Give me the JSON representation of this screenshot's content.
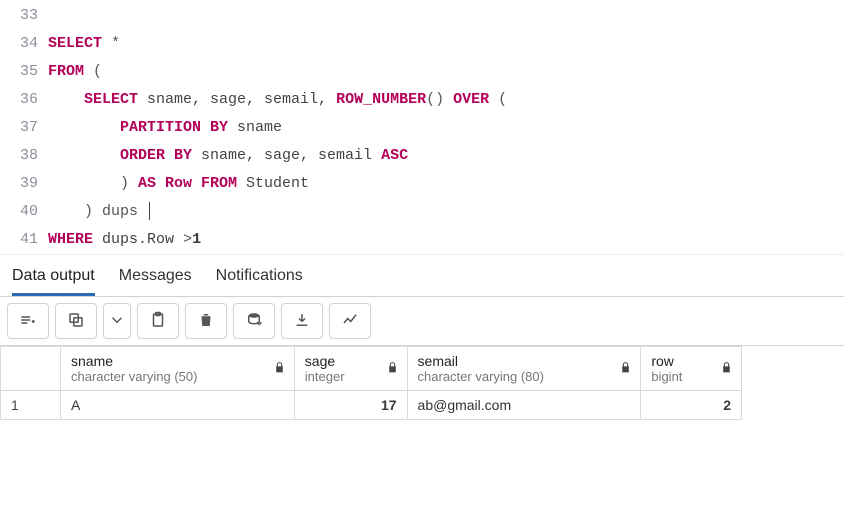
{
  "editor": {
    "lines": [
      {
        "n": 33,
        "tokens": []
      },
      {
        "n": 34,
        "tokens": [
          {
            "t": "SELECT",
            "c": "kw"
          },
          {
            "t": " *",
            "c": "punct"
          }
        ]
      },
      {
        "n": 35,
        "tokens": [
          {
            "t": "FROM",
            "c": "kw"
          },
          {
            "t": " (",
            "c": "punct"
          }
        ]
      },
      {
        "n": 36,
        "tokens": [
          {
            "t": "    ",
            "c": ""
          },
          {
            "t": "SELECT",
            "c": "kw"
          },
          {
            "t": " sname, sage, semail, ",
            "c": "id"
          },
          {
            "t": "ROW_NUMBER",
            "c": "kw"
          },
          {
            "t": "() ",
            "c": "punct"
          },
          {
            "t": "OVER",
            "c": "kw"
          },
          {
            "t": " (",
            "c": "punct"
          }
        ]
      },
      {
        "n": 37,
        "tokens": [
          {
            "t": "        ",
            "c": ""
          },
          {
            "t": "PARTITION BY",
            "c": "kw"
          },
          {
            "t": " sname",
            "c": "id"
          }
        ]
      },
      {
        "n": 38,
        "tokens": [
          {
            "t": "        ",
            "c": ""
          },
          {
            "t": "ORDER BY",
            "c": "kw"
          },
          {
            "t": " sname, sage, semail ",
            "c": "id"
          },
          {
            "t": "ASC",
            "c": "kw"
          }
        ]
      },
      {
        "n": 39,
        "tokens": [
          {
            "t": "        ) ",
            "c": "punct"
          },
          {
            "t": "AS Row FROM",
            "c": "kw"
          },
          {
            "t": " Student",
            "c": "id"
          }
        ]
      },
      {
        "n": 40,
        "tokens": [
          {
            "t": "    ) dups ",
            "c": "punct"
          }
        ],
        "cursor": true
      },
      {
        "n": 41,
        "tokens": [
          {
            "t": "WHERE",
            "c": "kw"
          },
          {
            "t": " dups",
            "c": "id"
          },
          {
            "t": ".",
            "c": "punct"
          },
          {
            "t": "Row ",
            "c": "id"
          },
          {
            "t": ">",
            "c": "punct"
          },
          {
            "t": "1",
            "c": "num"
          }
        ]
      }
    ]
  },
  "tabs": {
    "items": [
      {
        "label": "Data output",
        "active": true
      },
      {
        "label": "Messages",
        "active": false
      },
      {
        "label": "Notifications",
        "active": false
      }
    ]
  },
  "toolbar": {
    "buttons": [
      {
        "name": "add-row-icon"
      },
      {
        "name": "copy-icon"
      },
      {
        "name": "dropdown-icon"
      },
      {
        "name": "paste-icon"
      },
      {
        "name": "delete-icon"
      },
      {
        "name": "save-data-icon"
      },
      {
        "name": "download-icon"
      },
      {
        "name": "chart-icon"
      }
    ]
  },
  "grid": {
    "columns": [
      {
        "name": "sname",
        "type": "character varying (50)"
      },
      {
        "name": "sage",
        "type": "integer"
      },
      {
        "name": "semail",
        "type": "character varying (80)"
      },
      {
        "name": "row",
        "type": "bigint"
      }
    ],
    "rows": [
      {
        "n": "1",
        "cells": [
          {
            "v": "A",
            "align": "left"
          },
          {
            "v": "17",
            "align": "right"
          },
          {
            "v": "ab@gmail.com",
            "align": "left"
          },
          {
            "v": "2",
            "align": "right"
          }
        ]
      }
    ]
  }
}
